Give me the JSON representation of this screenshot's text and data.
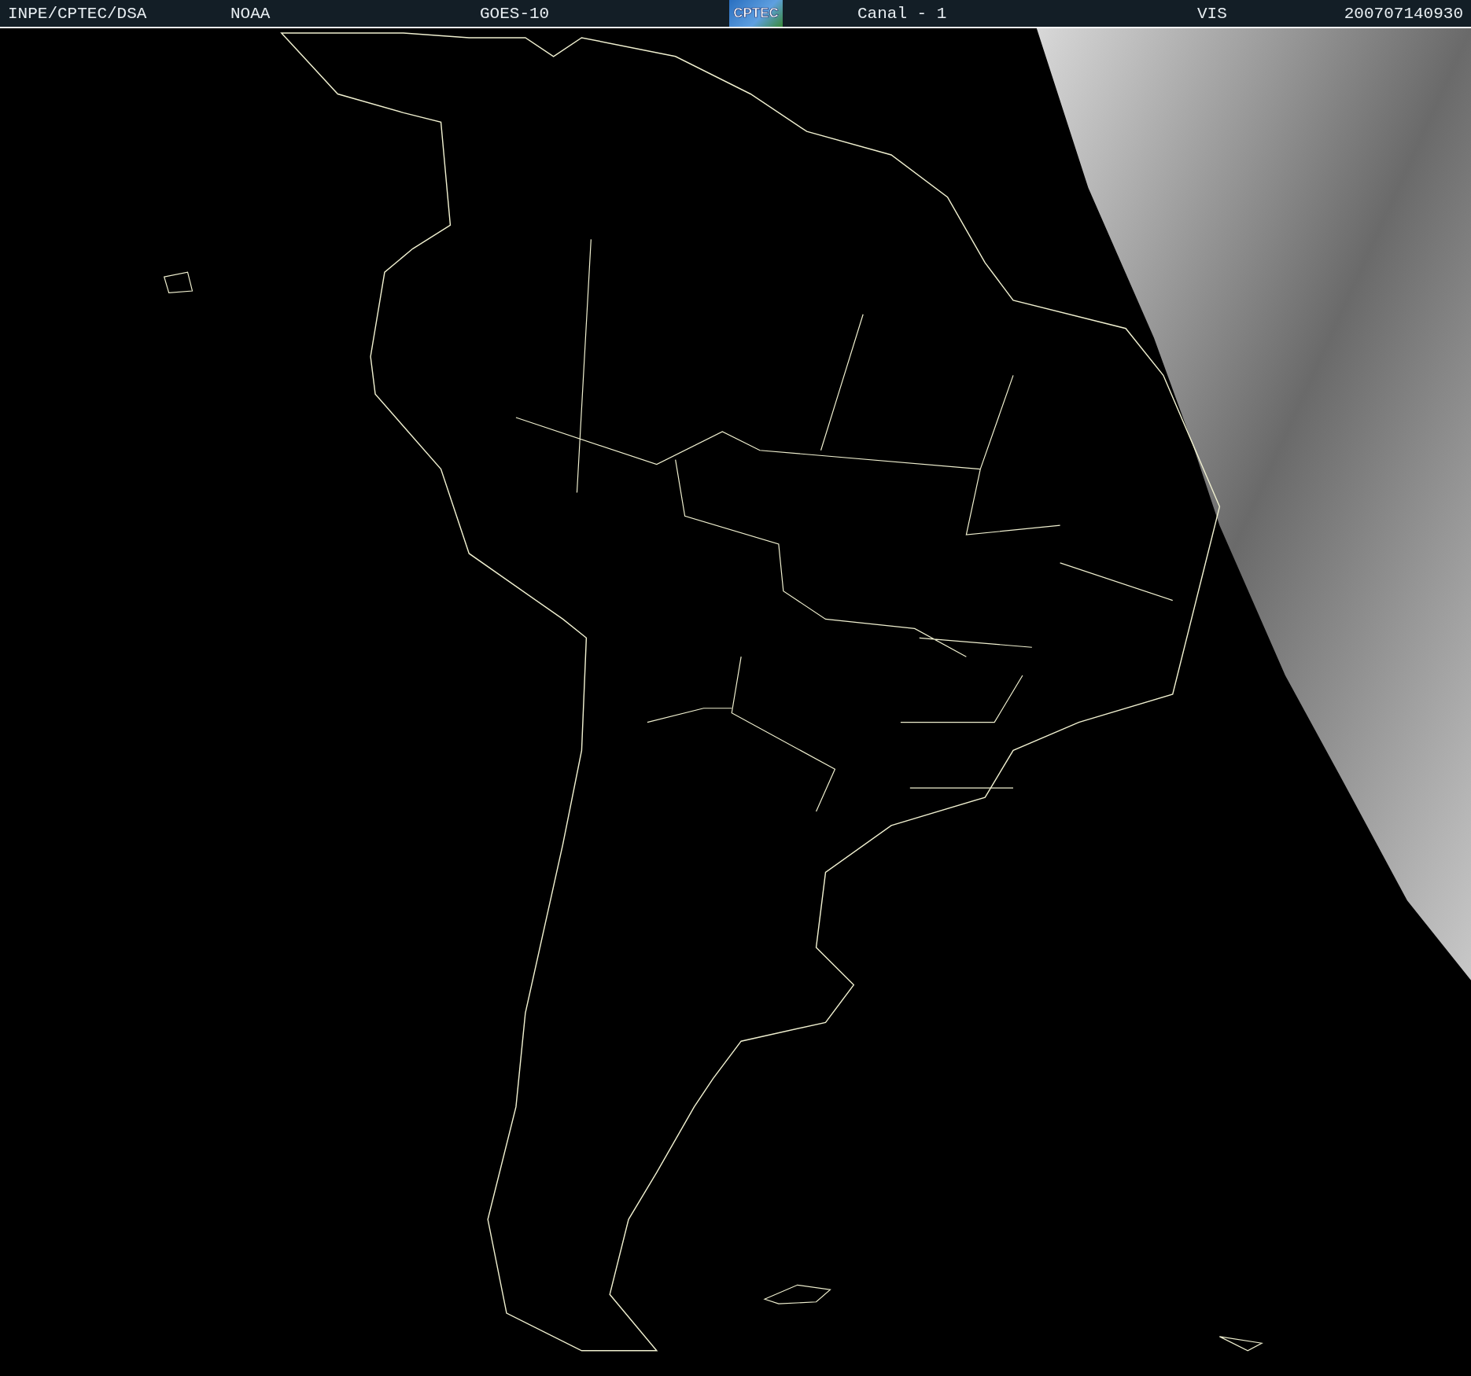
{
  "header": {
    "agency": "INPE/CPTEC/DSA",
    "source": "NOAA",
    "satellite": "GOES-10",
    "logo": "CPTEC",
    "channel": "Canal - 1",
    "band": "VIS",
    "timestamp": "200707140930"
  }
}
